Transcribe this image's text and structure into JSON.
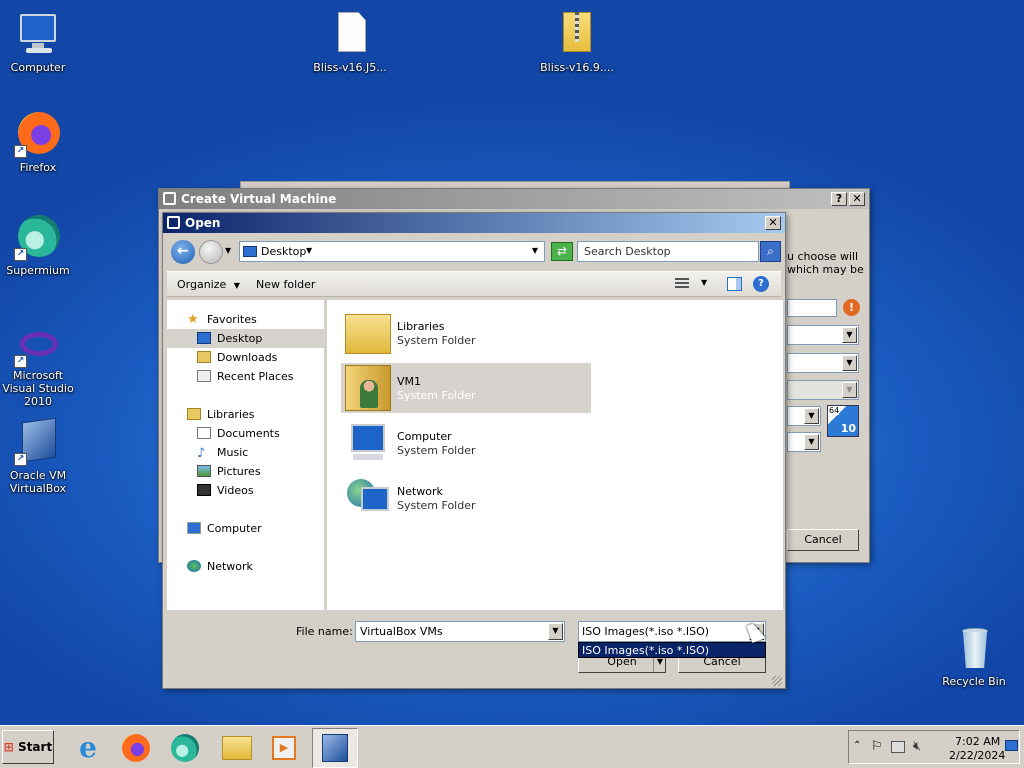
{
  "desktop_icons": [
    {
      "label": "Computer"
    },
    {
      "label": "Bliss-v16.J5..."
    },
    {
      "label": "Bliss-v16.9...."
    },
    {
      "label": "Firefox"
    },
    {
      "label": "Supermium"
    },
    {
      "label": "Microsoft Visual Studio 2010"
    },
    {
      "label": "Oracle VM VirtualBox"
    },
    {
      "label": "Recycle Bin"
    }
  ],
  "create_vm": {
    "title": "Create Virtual Machine",
    "help_btn": "?",
    "close_btn": "✕",
    "text_fragment_1": "u choose will",
    "text_fragment_2": "which may be",
    "os_badge": "64",
    "os_version": "10",
    "cancel": "Cancel"
  },
  "open_dialog": {
    "title": "Open",
    "close_btn": "✕",
    "address": "Desktop",
    "search_placeholder": "Search Desktop",
    "organize": "Organize",
    "new_folder": "New folder",
    "nav": {
      "favorites": "Favorites",
      "desktop": "Desktop",
      "downloads": "Downloads",
      "recent": "Recent Places",
      "libraries": "Libraries",
      "documents": "Documents",
      "music": "Music",
      "pictures": "Pictures",
      "videos": "Videos",
      "computer": "Computer",
      "network": "Network"
    },
    "items": [
      {
        "name": "Libraries",
        "type": "System Folder"
      },
      {
        "name": "VM1",
        "type": "System Folder"
      },
      {
        "name": "Computer",
        "type": "System Folder"
      },
      {
        "name": "Network",
        "type": "System Folder"
      }
    ],
    "file_name_label": "File name:",
    "file_name_value": "VirtualBox VMs",
    "file_type_value": "ISO Images(*.iso *.ISO)",
    "dropdown_option": "ISO Images(*.iso *.ISO)",
    "open_btn": "Open",
    "cancel_btn": "Cancel"
  },
  "taskbar": {
    "start": "Start",
    "time": "7:02 AM",
    "date": "2/22/2024"
  },
  "colors": {
    "accent": "#0a246a",
    "selection": "#d6d3ce",
    "title_gradient_end": "#a6caf0"
  }
}
